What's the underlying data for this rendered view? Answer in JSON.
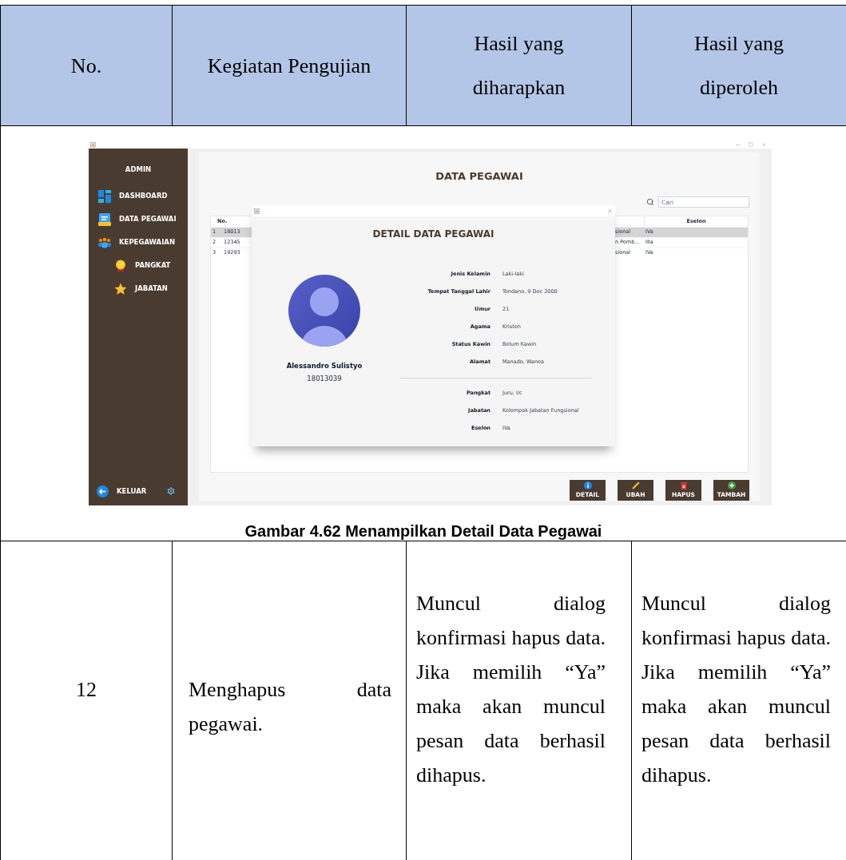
{
  "table": {
    "columns": [
      "No.",
      "Kegiatan Pengujian",
      "Hasil yang diharapkan",
      "Hasil yang diperoleh"
    ],
    "figure": {
      "caption": "Gambar 4.62 Menampilkan Detail Data Pegawai",
      "app": {
        "sidebar": {
          "title": "ADMIN",
          "items": [
            {
              "label": "DASHBOARD",
              "kind": "dashboard"
            },
            {
              "label": "DATA PEGAWAI",
              "kind": "document"
            },
            {
              "label": "KEPEGAWAIAN",
              "kind": "people",
              "children": [
                {
                  "label": "PANGKAT",
                  "kind": "medal"
                },
                {
                  "label": "JABATAN",
                  "kind": "star"
                }
              ]
            }
          ],
          "logout": "KELUAR"
        },
        "main": {
          "title": "DATA PEGAWAI",
          "search": {
            "placeholder": "Cari"
          },
          "grid": {
            "header": [
              "No.",
              "Eselon"
            ],
            "rows": [
              {
                "cells": [
                  "1",
                  "18013",
                  "sional",
                  "IVa"
                ],
                "selected": true
              },
              {
                "cells": [
                  "2",
                  "12345",
                  "n Pemb…",
                  "IIIa"
                ],
                "selected": false
              },
              {
                "cells": [
                  "3",
                  "19293",
                  "sional",
                  "IVa"
                ],
                "selected": false
              }
            ]
          },
          "buttons": [
            {
              "label": "DETAIL",
              "kind": "info"
            },
            {
              "label": "UBAH",
              "kind": "edit"
            },
            {
              "label": "HAPUS",
              "kind": "delete"
            },
            {
              "label": "TAMBAH",
              "kind": "add"
            }
          ]
        },
        "dialog": {
          "title": "DETAIL DATA PEGAWAI",
          "name": "Alessandro Sulistyo",
          "id": "18013039",
          "groups": [
            [
              {
                "label": "Jenis Kelamin",
                "value": "Laki-laki"
              },
              {
                "label": "Tempat Tanggal Lahir",
                "value": "Tondano, 9 Dec 2000"
              },
              {
                "label": "Umur",
                "value": "21"
              },
              {
                "label": "Agama",
                "value": "Kristen"
              },
              {
                "label": "Status Kawin",
                "value": "Belum Kawin"
              },
              {
                "label": "Alamat",
                "value": "Manado, Wanea"
              }
            ],
            [
              {
                "label": "Pangkat",
                "value": "Juru, I/c"
              },
              {
                "label": "Jabatan",
                "value": "Kelompok Jabatan Fungsional"
              },
              {
                "label": "Eselon",
                "value": "IVa"
              }
            ]
          ]
        }
      }
    },
    "rows": [
      {
        "no": "12",
        "activity": "Menghapus data pegawai.",
        "expected": "Muncul dialog konfirmasi hapus data. Jika memilih “Ya” maka akan muncul pesan data berhasil dihapus.",
        "actual": "Muncul dialog konfirmasi hapus data. Jika memilih “Ya” maka akan muncul pesan data berhasil dihapus."
      }
    ]
  }
}
